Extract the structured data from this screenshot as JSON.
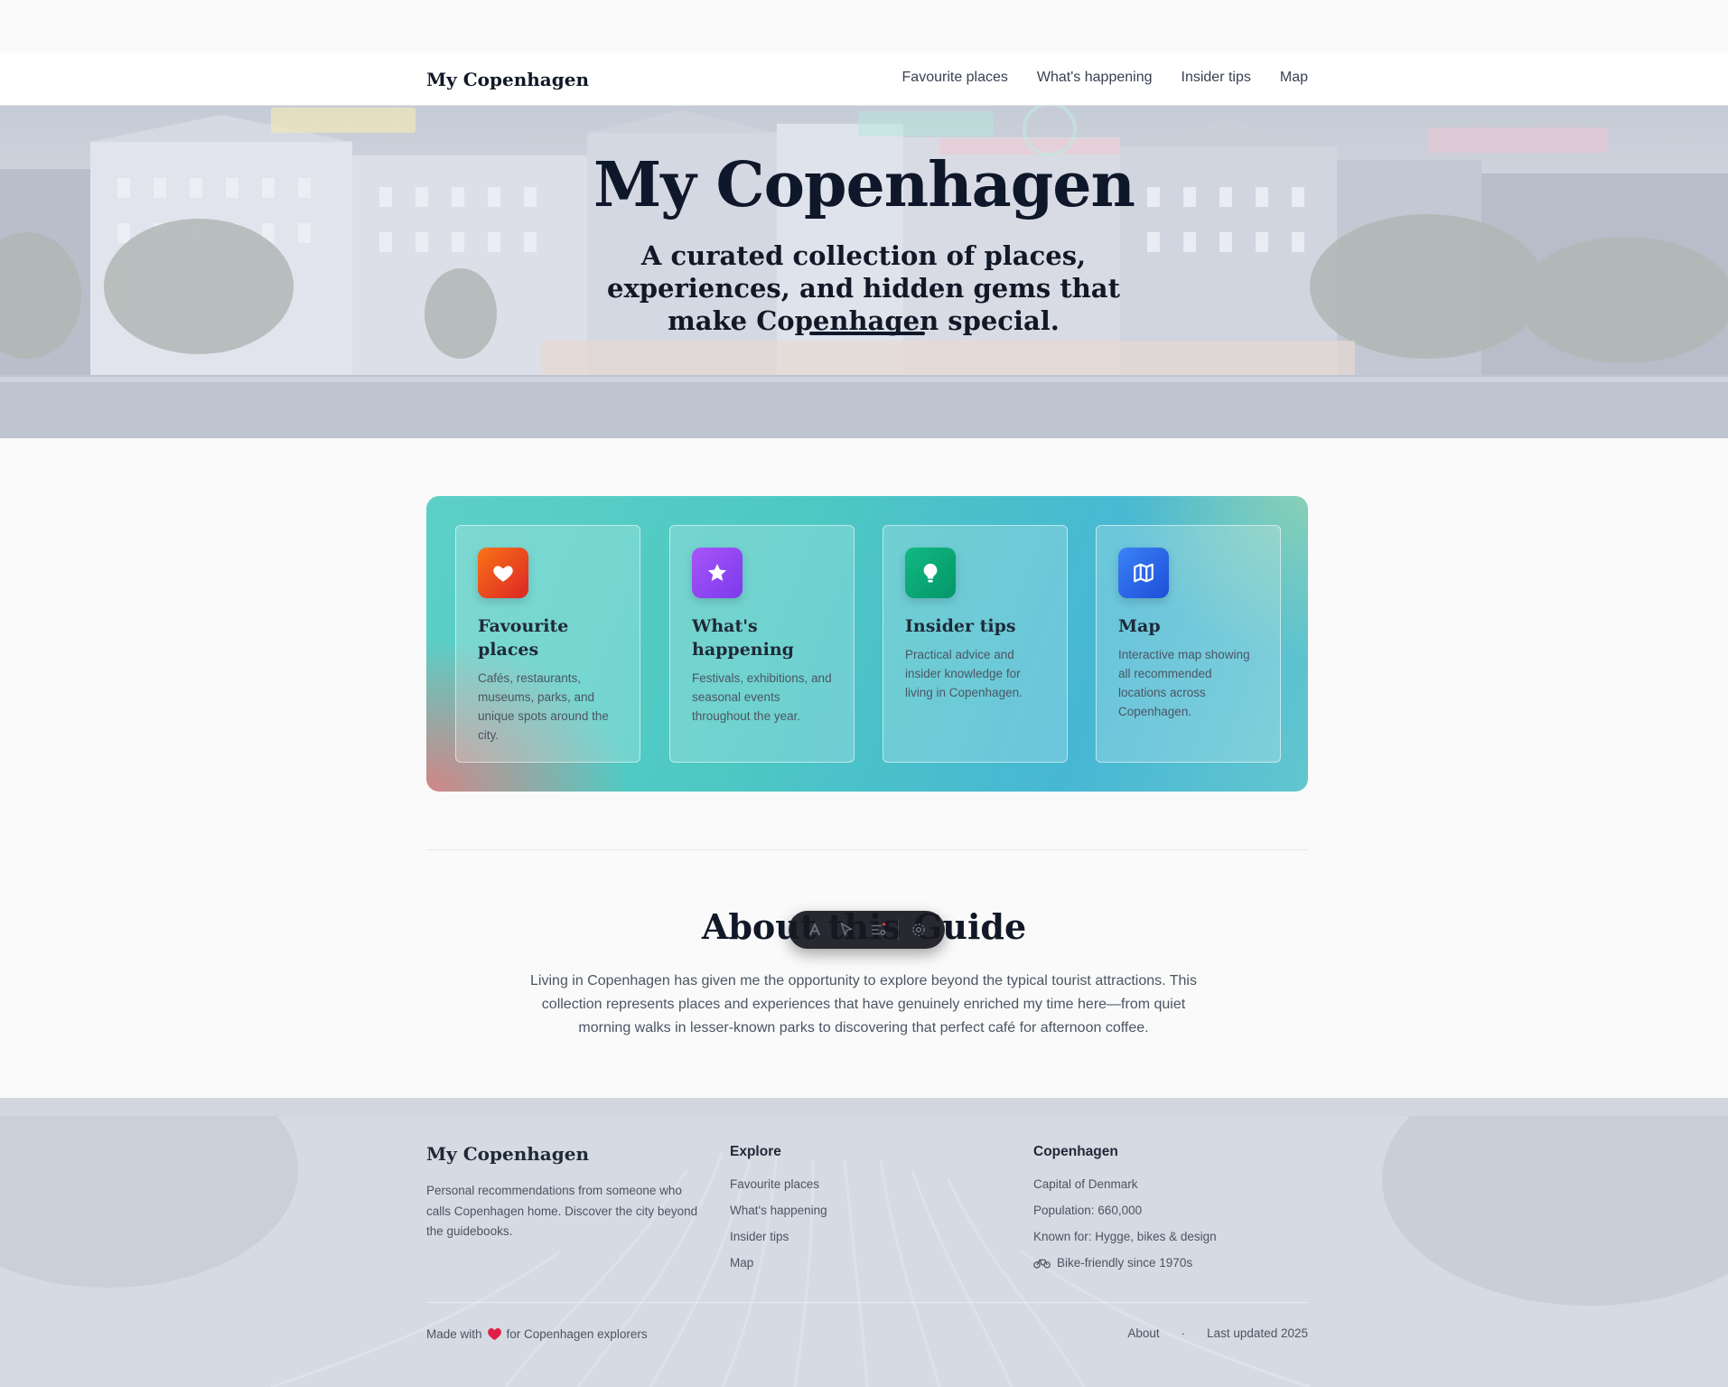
{
  "nav": {
    "brand": "My Copenhagen",
    "links": [
      "Favourite places",
      "What's happening",
      "Insider tips",
      "Map"
    ]
  },
  "hero": {
    "title": "My Copenhagen",
    "subtitle": "A curated collection of places, experiences, and hidden gems that make Copenhagen special."
  },
  "features": [
    {
      "title": "Favourite places",
      "text": "Cafés, restaurants, museums, parks, and unique spots around the city.",
      "icon": "heart-icon",
      "color": "#ea580c"
    },
    {
      "title": "What's happening",
      "text": "Festivals, exhibitions, and seasonal events throughout the year.",
      "icon": "star-icon",
      "color": "#8b5cf6"
    },
    {
      "title": "Insider tips",
      "text": "Practical advice and insider knowledge for living in Copenhagen.",
      "icon": "lightbulb-icon",
      "color": "#059669"
    },
    {
      "title": "Map",
      "text": "Interactive map showing all recommended locations across Copenhagen.",
      "icon": "map-icon",
      "color": "#2563eb"
    }
  ],
  "about": {
    "title": "About this Guide",
    "text": "Living in Copenhagen has given me the opportunity to explore beyond the typical tourist attractions. This collection represents places and experiences that have genuinely enriched my time here—from quiet morning walks in lesser-known parks to discovering that perfect café for afternoon coffee."
  },
  "toolbar": {
    "tools": [
      "text-icon",
      "cursor-icon",
      "filter-icon",
      "gear-icon"
    ]
  },
  "footer": {
    "brand": "My Copenhagen",
    "description": "Personal recommendations from someone who calls Copenhagen home. Discover the city beyond the guidebooks.",
    "explore": {
      "heading": "Explore",
      "links": [
        "Favourite places",
        "What's happening",
        "Insider tips",
        "Map"
      ]
    },
    "city": {
      "heading": "Copenhagen",
      "facts": [
        "Capital of Denmark",
        "Population: 660,000",
        "Known for: Hygge, bikes & design",
        "Bike-friendly since 1970s"
      ]
    },
    "made_prefix": "Made with",
    "made_suffix": "for Copenhagen explorers",
    "about_link": "About",
    "separator": "·",
    "updated": "Last updated 2025"
  }
}
